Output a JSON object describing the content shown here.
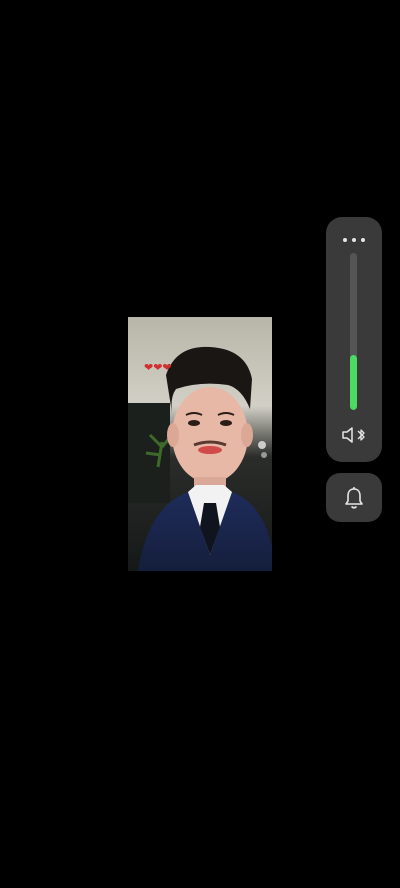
{
  "photo": {
    "subject": "selfie-photo",
    "emoji_row": "❤❤❤"
  },
  "volume": {
    "level_percent": 35,
    "fill_color": "#4cd964",
    "icons": {
      "more": "more-dots-icon",
      "output": "speaker-bluetooth-icon"
    }
  },
  "notification": {
    "icon": "bell-icon"
  }
}
